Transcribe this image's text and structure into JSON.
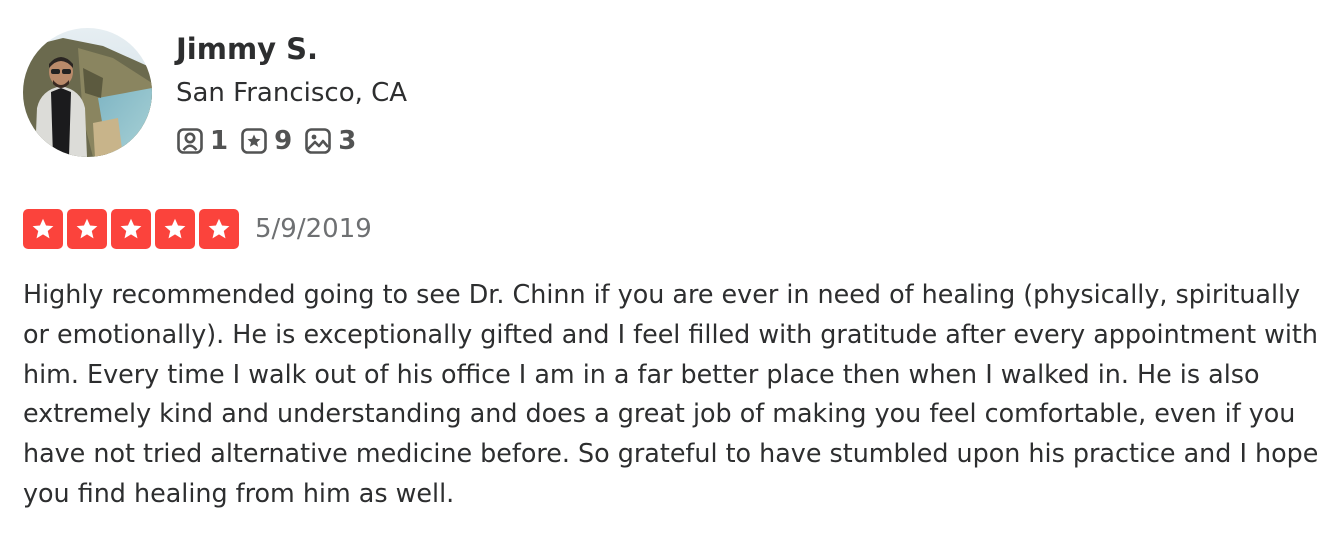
{
  "user": {
    "name": "Jimmy S.",
    "location": "San Francisco, CA",
    "stats": {
      "friends": "1",
      "reviews": "9",
      "photos": "3"
    },
    "avatar_icon": "user-avatar-photo"
  },
  "review": {
    "rating": 5,
    "rating_max": 5,
    "date": "5/9/2019",
    "text": "Highly recommended going to see Dr. Chinn if you are ever in need of healing (physically, spiritually or emotionally). He is exceptionally gifted and I feel filled with gratitude after every appointment with him. Every time I walk out of his office I am in a far better place then when I walked in. He is also extremely kind and understanding and does a great job of making you feel comfortable, even if you have not tried alternative medicine before. So grateful to have stumbled upon his practice and I hope you find healing from him as well."
  },
  "colors": {
    "star_red": "#fb433c",
    "text_dark": "#2d2e2f",
    "text_muted": "#6e7072",
    "icon_gray": "#525353"
  },
  "icons": {
    "friends": "friends-icon",
    "reviews": "reviews-star-icon",
    "photos": "photos-icon",
    "star": "star-icon"
  }
}
